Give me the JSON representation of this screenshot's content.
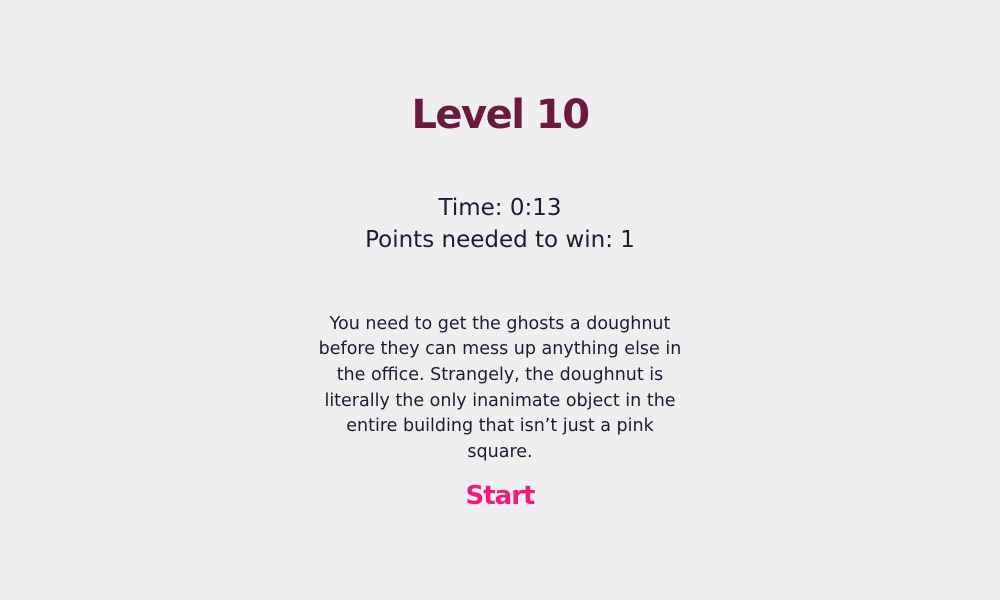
{
  "level": {
    "title": "Level 10"
  },
  "stats": {
    "time": "Time: 0:13",
    "points_needed": "Points needed to win: 1"
  },
  "description": "You need to get the ghosts a doughnut before they can mess up anything else in the office. Strangely, the doughnut is literally the only inanimate object in the entire building that isn’t just a pink square.",
  "start_button": {
    "label": "Start"
  },
  "colors": {
    "background": "#efefef",
    "title": "#6b1a3f",
    "text": "#1d1b33",
    "start": "#ee1d7a"
  }
}
